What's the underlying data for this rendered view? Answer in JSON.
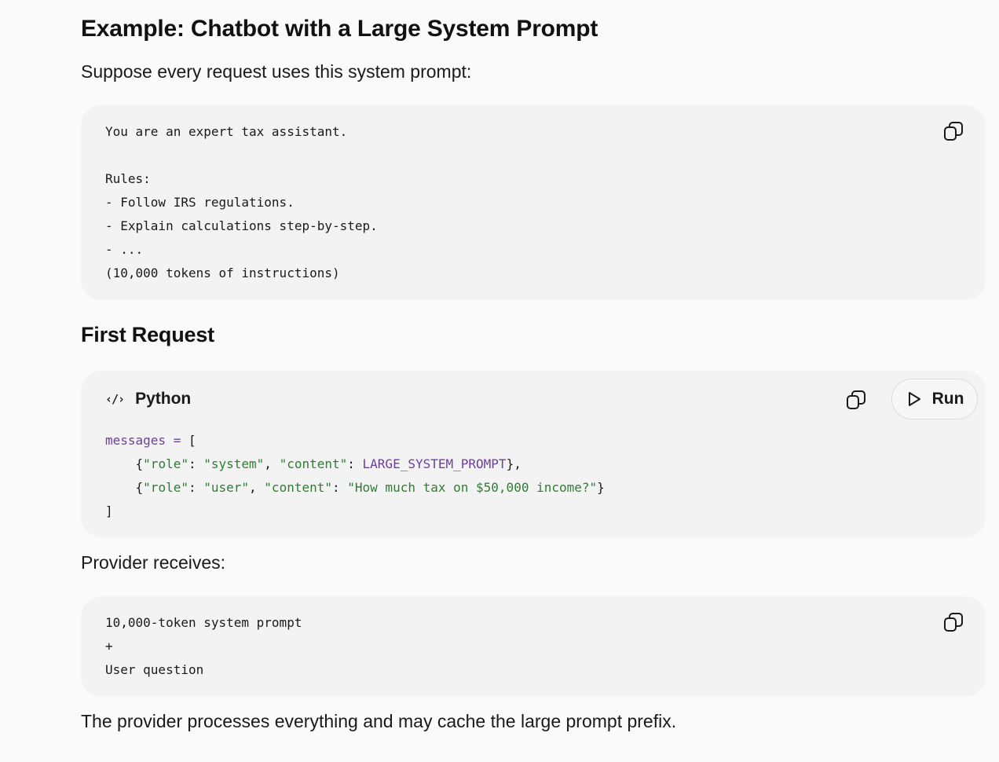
{
  "heading_main": "Example: Chatbot with a Large System Prompt",
  "intro": "Suppose every request uses this system prompt:",
  "system_prompt_block": {
    "lines": [
      "You are an expert tax assistant.",
      "",
      "Rules:",
      "- Follow IRS regulations.",
      "- Explain calculations step-by-step.",
      "- ...",
      "(10,000 tokens of instructions)"
    ],
    "copy_icon": "copy-icon"
  },
  "heading_sub": "First Request",
  "python_block": {
    "language": "Python",
    "language_icon": "code-icon",
    "run_label": "Run",
    "run_icon": "play-icon",
    "copy_icon": "copy-icon",
    "code": {
      "var": "messages",
      "op": "=",
      "open": "[",
      "row1": {
        "k1": "\"role\"",
        "v1": "\"system\"",
        "k2": "\"content\"",
        "v2": "LARGE_SYSTEM_PROMPT"
      },
      "row2": {
        "k1": "\"role\"",
        "v1": "\"user\"",
        "k2": "\"content\"",
        "v2": "\"How much tax on $50,000 income?\""
      },
      "close": "]"
    }
  },
  "provider_label": "Provider receives:",
  "provider_block": {
    "lines": [
      "10,000-token system prompt",
      "+",
      "User question"
    ],
    "copy_icon": "copy-icon"
  },
  "closing": "The provider processes everything and may cache the large prompt prefix."
}
